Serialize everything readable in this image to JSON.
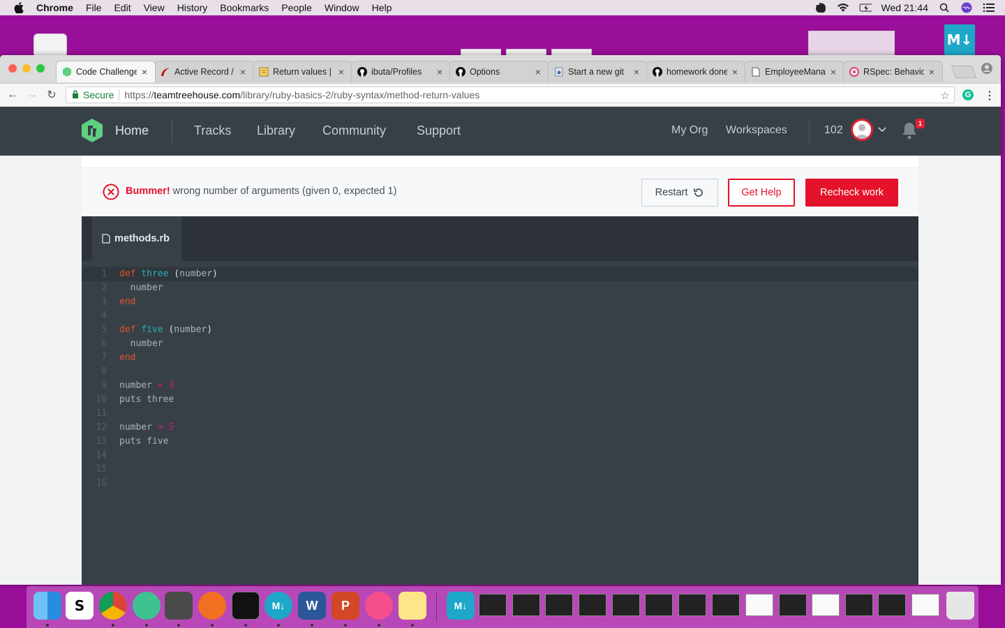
{
  "menubar": {
    "app": "Chrome",
    "items": [
      "File",
      "Edit",
      "View",
      "History",
      "Bookmarks",
      "People",
      "Window",
      "Help"
    ],
    "clock": "Wed 21:44"
  },
  "desktop": {
    "md_app_label": "M↓"
  },
  "tabs": [
    {
      "title": "Code Challenge",
      "icon": "treehouse-icon",
      "active": true
    },
    {
      "title": "Active Record /",
      "icon": "rails-icon"
    },
    {
      "title": "Return values |",
      "icon": "ruby-doc-icon"
    },
    {
      "title": "ibuta/Profiles",
      "icon": "github-icon"
    },
    {
      "title": "Options",
      "icon": "github-icon"
    },
    {
      "title": "Start a new git",
      "icon": "page-icon"
    },
    {
      "title": "homework done",
      "icon": "github-icon"
    },
    {
      "title": "EmployeeMana",
      "icon": "document-icon"
    },
    {
      "title": "RSpec: Behavio",
      "icon": "rspec-icon"
    }
  ],
  "address": {
    "secure_label": "Secure",
    "scheme": "https://",
    "host": "teamtreehouse.com",
    "path": "/library/ruby-basics-2/ruby-syntax/method-return-values"
  },
  "site": {
    "home": "Home",
    "nav": [
      "Tracks",
      "Library",
      "Community",
      "Support"
    ],
    "my_org": "My Org",
    "workspaces": "Workspaces",
    "points": "102",
    "notifications": "1"
  },
  "alert": {
    "title": "Bummer!",
    "message": "wrong number of arguments (given 0, expected 1)",
    "restart": "Restart",
    "get_help": "Get Help",
    "recheck": "Recheck work"
  },
  "editor": {
    "filename": "methods.rb",
    "lines": [
      "def three (number)",
      "  number",
      "end",
      "",
      "def five (number)",
      "  number",
      "end",
      "",
      "number = 3",
      "puts three",
      "",
      "number = 5",
      "puts five",
      "",
      "",
      ""
    ]
  },
  "colors": {
    "accent_red": "#e4122a",
    "header_bg": "#384047",
    "treehouse_green": "#5fcf80",
    "desktop": "#9a0f9a"
  }
}
